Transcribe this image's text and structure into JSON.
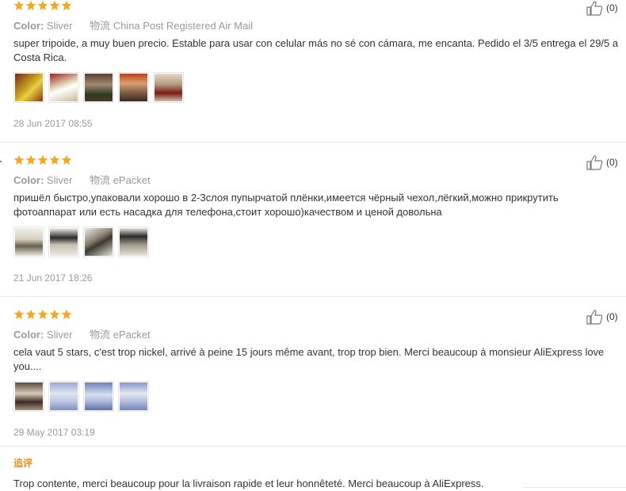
{
  "reviews": [
    {
      "color_label": "Color:",
      "color_value": "Sliver",
      "logistics_label": "物流",
      "logistics_value": "China Post Registered Air Mail",
      "text": "super tripoide, a muy buen precio. Estable para usar con celular más no sé con cámara, me encanta. Pedido el 3/5 entrega el 29/5 a Costa Rica.",
      "photo_count": 5,
      "date": "28 Jun 2017 08:55",
      "helpful_count": "(0)",
      "rating": 5
    },
    {
      "color_label": "Color:",
      "color_value": "Sliver",
      "logistics_label": "物流",
      "logistics_value": "ePacket",
      "text": "пришёл быстро,упаковали хорошо в 2-3слоя пупырчатой плёнки,имеется чёрный чехол,лёгкий,можно прикрутить фотоаппарат или есть насадка для телефона,стоит хорошо)качеством и ценой довольна",
      "photo_count": 4,
      "date": "21 Jun 2017 18:26",
      "helpful_count": "(0)",
      "rating": 5
    },
    {
      "color_label": "Color:",
      "color_value": "Sliver",
      "logistics_label": "物流",
      "logistics_value": "ePacket",
      "text": "cela vaut 5 stars, c'est trop nickel, arrivé à peine 15 jours même avant, trop trop bien. Merci beaucoup à monsieur AliExpress love you....",
      "photo_count": 4,
      "date": "29 May 2017 03:19",
      "helpful_count": "(0)",
      "rating": 5
    }
  ],
  "additional_feedback": {
    "label": "追评",
    "text": "Trop contente, merci beaucoup pour la livraison rapide et leur honnêteté. Merci beaucoup à AliExpress."
  },
  "colors": {
    "star": "#f5a623",
    "additional_label": "#e88c1a"
  }
}
